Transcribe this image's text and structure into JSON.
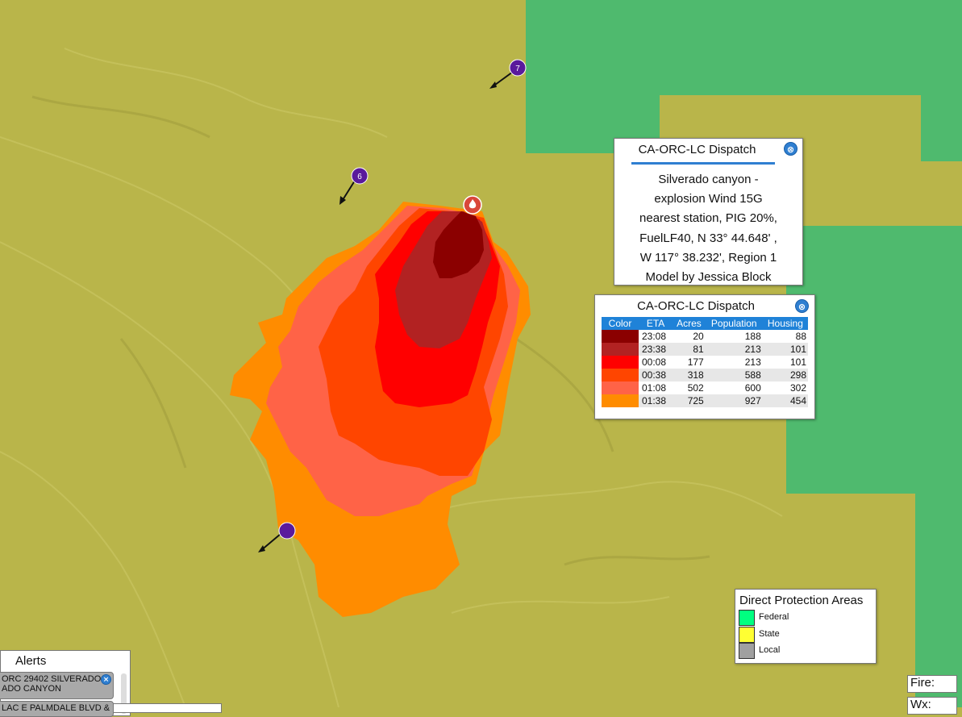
{
  "colors": {
    "local_base": "#b9b54a",
    "federal_area": "#4fba6e",
    "fire_origin": "#d9473a",
    "marker": "#5a1a9c",
    "accent": "#2f7fd1"
  },
  "icons": {
    "popup_close": "close-circle-icon",
    "fire_origin": "fire-marker-icon",
    "wind_marker": "wind-arrow-icon"
  },
  "wind_markers": [
    {
      "label": "7",
      "direction": "southwest"
    },
    {
      "label": "6",
      "direction": "southwest"
    },
    {
      "label": "",
      "direction": "southwest"
    }
  ],
  "dispatch_popup": {
    "title": "CA-ORC-LC Dispatch",
    "close_label": "⊗",
    "lines": [
      "Silverado canyon -",
      "explosion Wind 15G",
      "nearest station, PIG 20%,",
      "FuelLF40, N 33° 44.648' ,",
      "W 117° 38.232', Region 1",
      "Model by Jessica Block"
    ]
  },
  "spread_popup": {
    "title": "CA-ORC-LC Dispatch",
    "close_label": "⊗",
    "headers": [
      "Color",
      "ETA",
      "Acres",
      "Population",
      "Housing"
    ],
    "rows": [
      {
        "color": "#8b0000",
        "eta": "23:08",
        "acres": "20",
        "population": "188",
        "housing": "88"
      },
      {
        "color": "#b22222",
        "eta": "23:38",
        "acres": "81",
        "population": "213",
        "housing": "101"
      },
      {
        "color": "#ff0000",
        "eta": "00:08",
        "acres": "177",
        "population": "213",
        "housing": "101"
      },
      {
        "color": "#ff4500",
        "eta": "00:38",
        "acres": "318",
        "population": "588",
        "housing": "298"
      },
      {
        "color": "#ff6347",
        "eta": "01:08",
        "acres": "502",
        "population": "600",
        "housing": "302"
      },
      {
        "color": "#ff8c00",
        "eta": "01:38",
        "acres": "725",
        "population": "927",
        "housing": "454"
      }
    ]
  },
  "legend": {
    "title": "Direct Protection Areas",
    "items": [
      {
        "label": "Federal",
        "color": "#00ff80"
      },
      {
        "label": "State",
        "color": "#ffff33"
      },
      {
        "label": "Local",
        "color": "#a0a0a0"
      }
    ]
  },
  "alerts": {
    "title": "Alerts",
    "items": [
      {
        "line1": "ORC 29402 SILVERADO",
        "line2": "ADO CANYON"
      },
      {
        "line1": "LAC E PALMDALE BLVD &",
        "line2": ""
      }
    ]
  },
  "status": {
    "fire_label": "Fire:",
    "wx_label": "Wx:"
  }
}
